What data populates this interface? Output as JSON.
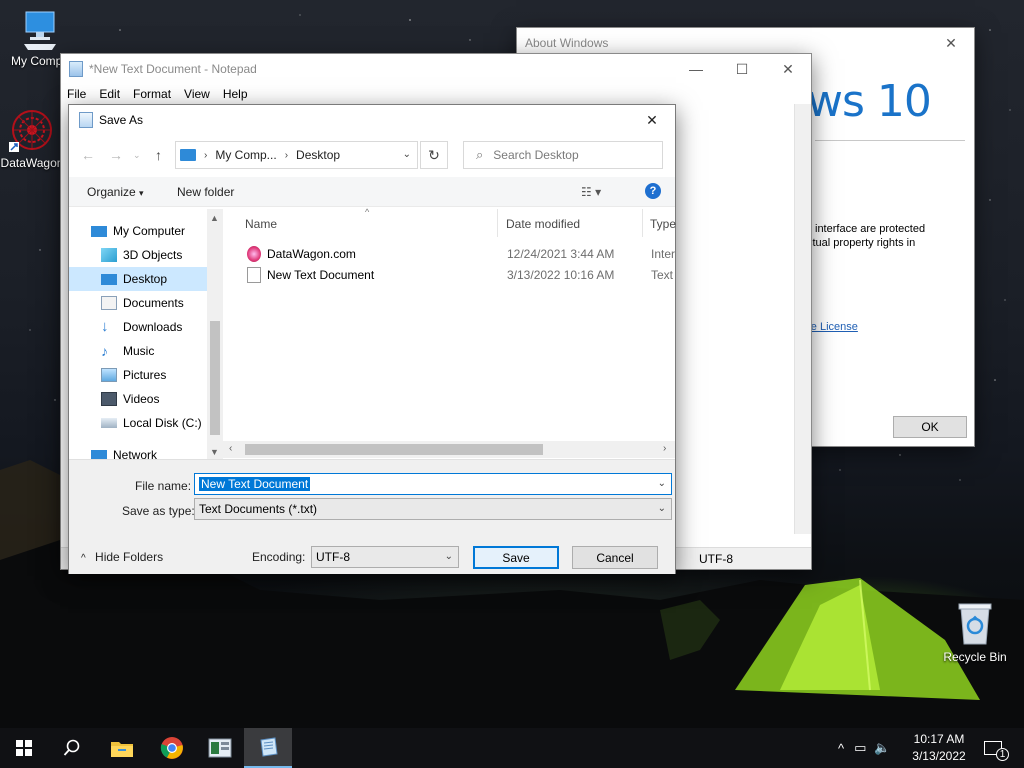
{
  "desktop": {
    "icons": [
      {
        "label": "My Compu",
        "icon": "computer-icon"
      },
      {
        "label": "DataWagon",
        "icon": "datawagon-icon"
      },
      {
        "label": "Recycle Bin",
        "icon": "recycle-bin-icon"
      }
    ]
  },
  "about_window": {
    "title": "About Windows",
    "logo_text": "ws 10",
    "text_line1": "interface are protected",
    "text_line2": "ctual property rights in",
    "link_text": "are License",
    "ok_label": "OK"
  },
  "notepad": {
    "title": "*New Text Document - Notepad",
    "menu": [
      "File",
      "Edit",
      "Format",
      "View",
      "Help"
    ],
    "status_encoding": "UTF-8"
  },
  "save_as": {
    "title": "Save As",
    "breadcrumb": [
      "My Comp...",
      "Desktop"
    ],
    "search_placeholder": "Search Desktop",
    "organize_label": "Organize",
    "new_folder_label": "New folder",
    "nav_items": [
      {
        "label": "My Computer",
        "icon": "computer-icon"
      },
      {
        "label": "3D Objects",
        "icon": "3d-objects-icon"
      },
      {
        "label": "Desktop",
        "icon": "desktop-folder-icon",
        "selected": true
      },
      {
        "label": "Documents",
        "icon": "documents-icon"
      },
      {
        "label": "Downloads",
        "icon": "downloads-icon"
      },
      {
        "label": "Music",
        "icon": "music-icon"
      },
      {
        "label": "Pictures",
        "icon": "pictures-icon"
      },
      {
        "label": "Videos",
        "icon": "videos-icon"
      },
      {
        "label": "Local Disk (C:)",
        "icon": "local-disk-icon"
      },
      {
        "label": "Network",
        "icon": "network-icon"
      }
    ],
    "columns": [
      "Name",
      "Date modified",
      "Type"
    ],
    "files": [
      {
        "name": "DataWagon.com",
        "date": "12/24/2021 3:44 AM",
        "type": "Intern",
        "icon": "internet-shortcut-icon"
      },
      {
        "name": "New Text Document",
        "date": "3/13/2022 10:16 AM",
        "type": "Text D",
        "icon": "text-file-icon"
      }
    ],
    "file_name_label": "File name:",
    "file_name_value": "New Text Document",
    "save_type_label": "Save as type:",
    "save_type_value": "Text Documents (*.txt)",
    "hide_folders_label": "Hide Folders",
    "encoding_label": "Encoding:",
    "encoding_value": "UTF-8",
    "save_label": "Save",
    "cancel_label": "Cancel"
  },
  "taskbar": {
    "items": [
      "start-icon",
      "search-icon",
      "file-explorer-icon",
      "chrome-icon",
      "app-icon",
      "notepad-icon"
    ],
    "time": "10:17 AM",
    "date": "3/13/2022",
    "notification_count": "1"
  }
}
